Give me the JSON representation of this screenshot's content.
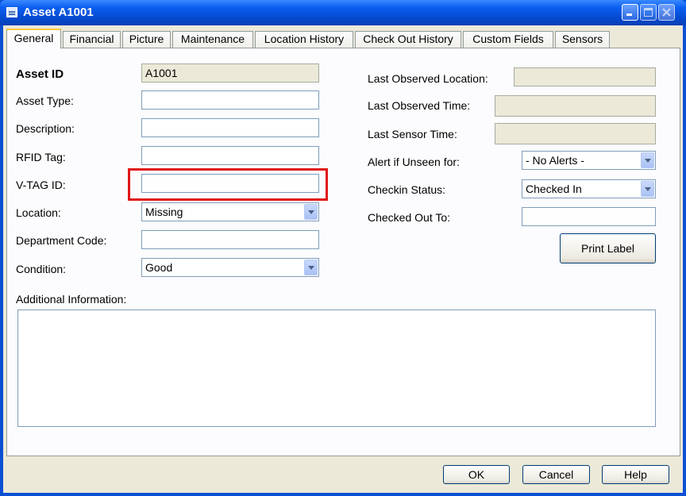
{
  "window": {
    "title": "Asset A1001"
  },
  "tabs": [
    "General",
    "Financial",
    "Picture",
    "Maintenance",
    "Location History",
    "Check Out History",
    "Custom Fields",
    "Sensors"
  ],
  "left": {
    "asset_id_label": "Asset ID",
    "asset_id_value": "A1001",
    "asset_type_label": "Asset Type:",
    "asset_type_value": "",
    "description_label": "Description:",
    "description_value": "",
    "rfid_label": "RFID Tag:",
    "rfid_value": "",
    "vtag_label": "V-TAG ID:",
    "vtag_value": "",
    "location_label": "Location:",
    "location_value": "Missing",
    "dept_label": "Department Code:",
    "dept_value": "",
    "condition_label": "Condition:",
    "condition_value": "Good",
    "additional_label": "Additional Information:",
    "additional_value": ""
  },
  "right": {
    "last_location_label": "Last Observed Location:",
    "last_location_value": "",
    "last_time_label": "Last Observed Time:",
    "last_time_value": "",
    "last_sensor_label": "Last Sensor Time:",
    "last_sensor_value": "",
    "alert_label": "Alert if Unseen for:",
    "alert_value": "- No Alerts -",
    "checkin_label": "Checkin Status:",
    "checkin_value": "Checked In",
    "checked_out_label": "Checked Out To:",
    "checked_out_value": "",
    "print_label": "Print Label"
  },
  "footer": {
    "ok": "OK",
    "cancel": "Cancel",
    "help": "Help"
  },
  "colors": {
    "titlebar": "#0a5ef0",
    "highlight": "#e01616",
    "dialog_bg": "#ece9d8"
  }
}
